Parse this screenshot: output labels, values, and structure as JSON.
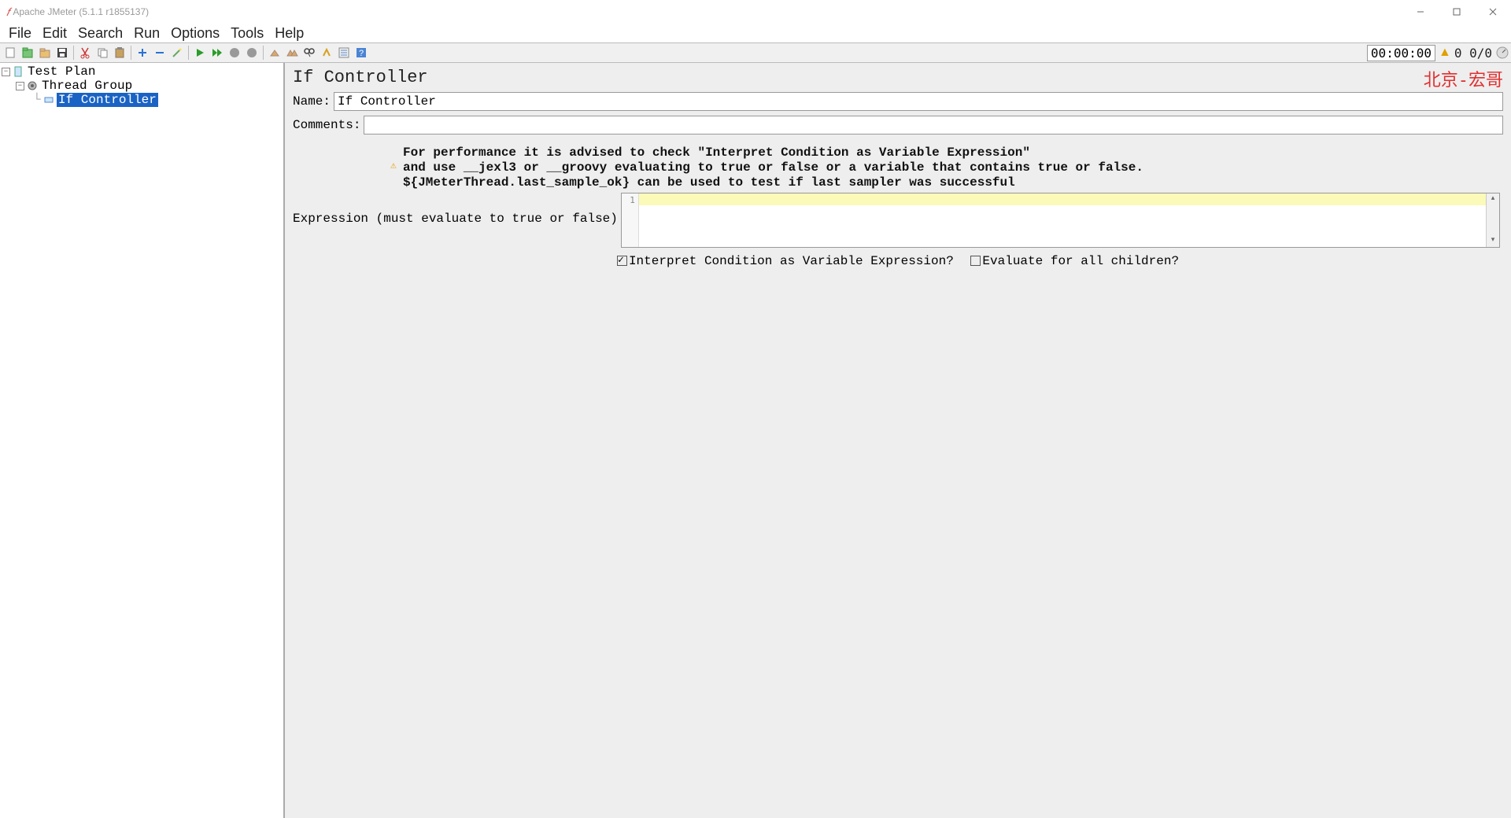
{
  "title": "Apache JMeter (5.1.1 r1855137)",
  "menus": [
    "File",
    "Edit",
    "Search",
    "Run",
    "Options",
    "Tools",
    "Help"
  ],
  "status": {
    "timer": "00:00:00",
    "counter": "0 0/0"
  },
  "tree": {
    "root": "Test Plan",
    "child": "Thread Group",
    "leaf": "If Controller"
  },
  "panel": {
    "heading": "If Controller",
    "name_label": "Name:",
    "name_value": "If Controller",
    "comments_label": "Comments:",
    "comments_value": "",
    "advice_line1": "For performance it is advised to check \"Interpret Condition as Variable Expression\"",
    "advice_line2": "and use __jexl3 or __groovy evaluating to true or false or a variable that contains true or false.",
    "advice_line3": "${JMeterThread.last_sample_ok} can be used to test if last sampler was successful",
    "expr_label": "Expression (must evaluate to true or false)",
    "gutter_line": "1",
    "check1": "Interpret Condition as Variable Expression?",
    "check1_checked": true,
    "check2": "Evaluate for all children?",
    "check2_checked": false
  },
  "watermark": "北京-宏哥"
}
